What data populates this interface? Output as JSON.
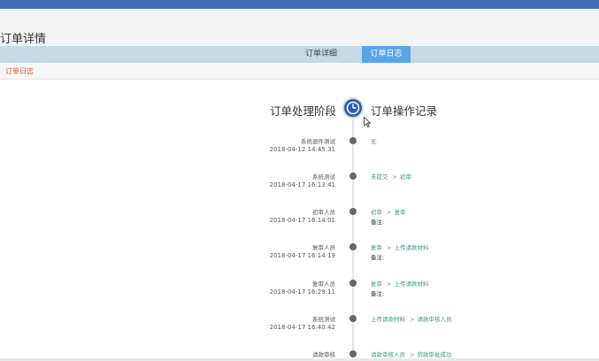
{
  "header": {
    "title": "订单详情"
  },
  "tabs": [
    {
      "label": "订单详细",
      "active": false
    },
    {
      "label": "订单日志",
      "active": true
    }
  ],
  "section": {
    "title": "订单日志"
  },
  "timeline": {
    "left_heading": "订单处理阶段",
    "right_heading": "订单操作记录",
    "entries": [
      {
        "who": "系统退件测试",
        "when": "2018-04-12 14:45:31",
        "from": "无",
        "to": "",
        "remark": ""
      },
      {
        "who": "系统测试",
        "when": "2018-04-17 16:13:41",
        "from": "未提交",
        "to": "初审",
        "remark": ""
      },
      {
        "who": "初审人员",
        "when": "2018-04-17 16:14:01",
        "from": "初审",
        "to": "复审",
        "remark": "备注:"
      },
      {
        "who": "复审人员",
        "when": "2018-04-17 16:14:19",
        "from": "复审",
        "to": "上传请款材料",
        "remark": "备注:"
      },
      {
        "who": "复审人员",
        "when": "2018-04-17 16:29:11",
        "from": "复审",
        "to": "上传请款材料",
        "remark": "备注:"
      },
      {
        "who": "系统测试",
        "when": "2018-04-17 16:40:42",
        "from": "上传请款材料",
        "to": "请款审核人员",
        "remark": ""
      },
      {
        "who": "请款审核",
        "when": "",
        "from": "请款审核人员",
        "to": "贷款审批成功",
        "remark": ""
      }
    ]
  },
  "colors": {
    "topbar": "#3e6db1",
    "tab_active": "#5aa5ea",
    "tab_bar": "#c6d9e4",
    "section_title": "#d35a34",
    "action_text": "#3d9a8c",
    "clock": "#2f5fa8"
  },
  "icons": {
    "heading_center": "clock-icon",
    "pointer": "cursor-icon"
  }
}
